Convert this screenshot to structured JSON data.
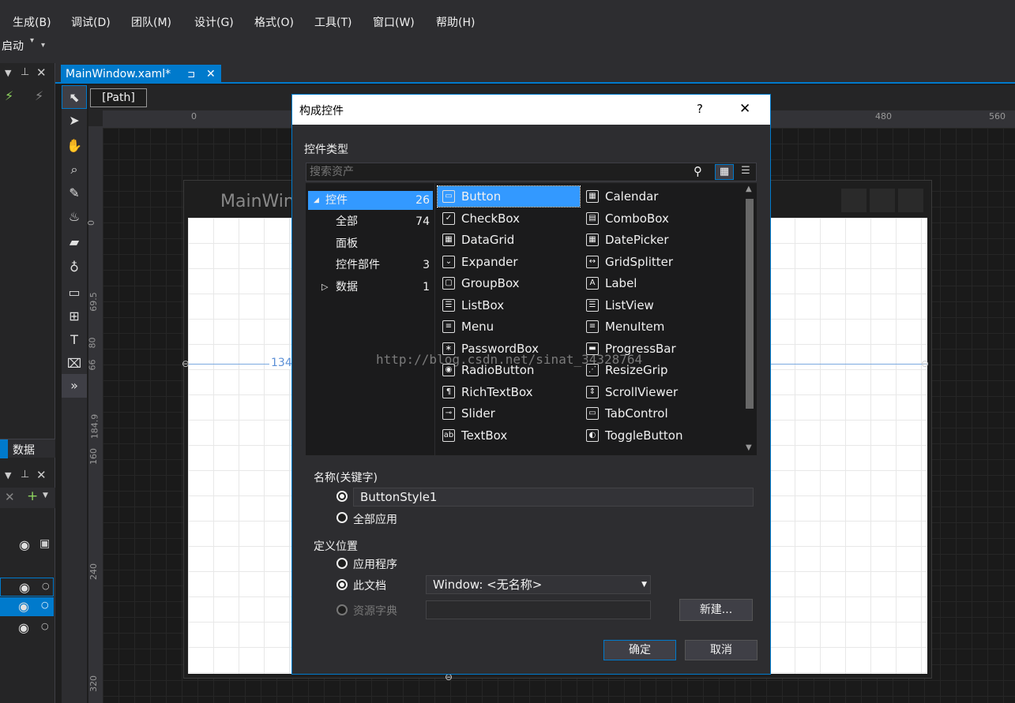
{
  "menu": [
    "生成(B)",
    "调试(D)",
    "团队(M)",
    "设计(G)",
    "格式(O)",
    "工具(T)",
    "窗口(W)",
    "帮助(H)"
  ],
  "toolbar": {
    "start_label": "启动"
  },
  "left_panel": {
    "tab_data": "数据"
  },
  "doc_tab": {
    "title": "MainWindow.xaml*",
    "pin": "⊐",
    "close": "✕"
  },
  "designer": {
    "breadcrumb": "[Path]",
    "ruler_top": [
      "0",
      "480",
      "560"
    ],
    "ruler_left": [
      "0",
      "69.5",
      "80",
      "66",
      "184.9",
      "160",
      "240",
      "320"
    ],
    "window_title": "MainWin",
    "margin_label": "134."
  },
  "dialog": {
    "title": "构成控件",
    "help": "?",
    "close": "✕",
    "section_type": "控件类型",
    "search_placeholder": "搜索资产",
    "tree": [
      {
        "label": "控件",
        "count": "26",
        "expander": "◢"
      },
      {
        "label": "全部",
        "count": "74"
      },
      {
        "label": "面板",
        "count": ""
      },
      {
        "label": "控件部件",
        "count": "3"
      },
      {
        "label": "数据",
        "count": "1",
        "expander": "▷"
      }
    ],
    "controls": [
      [
        "Button",
        "Calendar"
      ],
      [
        "CheckBox",
        "ComboBox"
      ],
      [
        "DataGrid",
        "DatePicker"
      ],
      [
        "Expander",
        "GridSplitter"
      ],
      [
        "GroupBox",
        "Label"
      ],
      [
        "ListBox",
        "ListView"
      ],
      [
        "Menu",
        "MenuItem"
      ],
      [
        "PasswordBox",
        "ProgressBar"
      ],
      [
        "RadioButton",
        "ResizeGrip"
      ],
      [
        "RichTextBox",
        "ScrollViewer"
      ],
      [
        "Slider",
        "TabControl"
      ],
      [
        "TextBox",
        "ToggleButton"
      ]
    ],
    "name_section": "名称(关键字)",
    "name_value": "ButtonStyle1",
    "apply_all": "全部应用",
    "define_section": "定义位置",
    "opt_app": "应用程序",
    "opt_doc": "此文档",
    "doc_select": "Window: <无名称>",
    "opt_dict": "资源字典",
    "new_button": "新建...",
    "ok_button": "确定",
    "cancel_button": "取消"
  },
  "watermark": "http://blog.csdn.net/sinat_34328764"
}
